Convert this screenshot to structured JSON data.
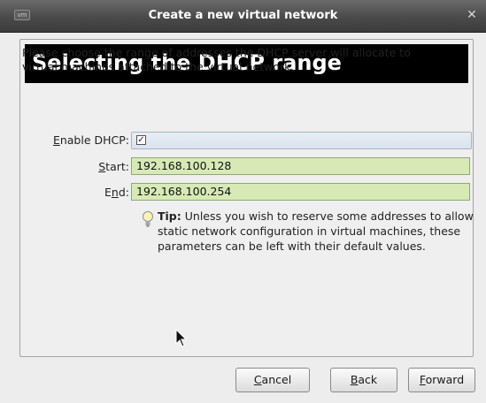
{
  "window": {
    "title": "Create a new virtual network",
    "app_icon_text": "vm",
    "close_icon": "close-icon"
  },
  "page": {
    "heading": "Selecting the DHCP range",
    "description": "Please choose the range of addresses the DHCP server will allocate to virtual machines attached to the virtual network."
  },
  "form": {
    "enable_dhcp_label_mnemonic": "E",
    "enable_dhcp_label_rest": "nable DHCP:",
    "enable_dhcp_checked": true,
    "start_label_mnemonic": "S",
    "start_label_rest": "tart:",
    "start_value": "192.168.100.128",
    "end_label_prefix": "E",
    "end_label_mnemonic": "n",
    "end_label_rest": "d:",
    "end_value": "192.168.100.254"
  },
  "tip": {
    "icon": "lightbulb-icon",
    "prefix": "Tip:",
    "text": "Unless you wish to reserve some addresses to allow static network configuration in virtual machines, these parameters can be left with their default values."
  },
  "buttons": {
    "cancel_mnemonic": "C",
    "cancel_rest": "ancel",
    "back_mnemonic": "B",
    "back_rest": "ack",
    "forward_mnemonic": "F",
    "forward_rest": "orward"
  },
  "colors": {
    "valid_field_bg": "#d7eab6",
    "header_bg": "#000000"
  }
}
